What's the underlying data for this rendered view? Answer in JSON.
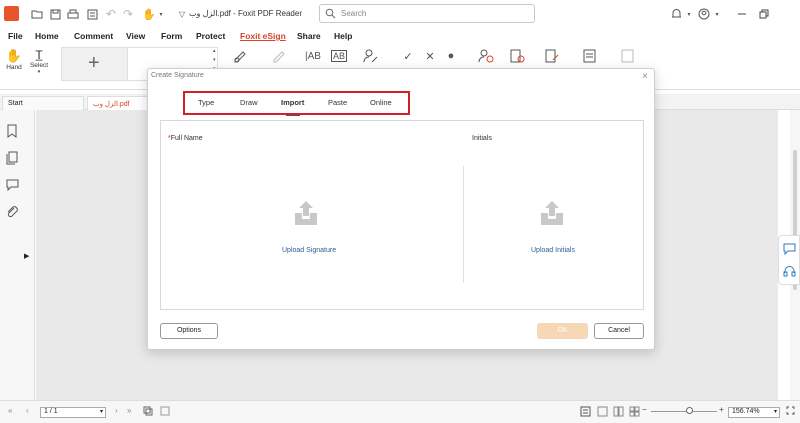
{
  "window": {
    "title": "الزل وب.pdf - Foxit PDF Reader"
  },
  "search": {
    "placeholder": "Search"
  },
  "menu": [
    "File",
    "Home",
    "Comment",
    "View",
    "Form",
    "Protect",
    "Foxit eSign",
    "Share",
    "Help"
  ],
  "menu_active": "Foxit eSign",
  "ribbon": {
    "hand_label": "Hand",
    "select_label": "Select",
    "add_symbol": "+"
  },
  "tabs": {
    "start": "Start",
    "doc": "الزل وب.pdf"
  },
  "status": {
    "page_value": "1 / 1",
    "zoom_value": "156.74%"
  },
  "dialog": {
    "title": "Create Signature",
    "close": "×",
    "tabs": [
      "Type",
      "Draw",
      "Import",
      "Paste",
      "Online"
    ],
    "active_tab": "Import",
    "required_mark": "*",
    "full_name_label": "Full Name",
    "initials_label": "Initials",
    "upload_signature": "Upload Signature",
    "upload_initials": "Upload Initials",
    "options_button": "Options",
    "ok_button": "OK",
    "cancel_button": "Cancel"
  },
  "colors": {
    "accent": "#d9452b",
    "highlight_border": "#d0202a",
    "link": "#2a5d96",
    "ok_disabled": "#f6d7b6"
  }
}
